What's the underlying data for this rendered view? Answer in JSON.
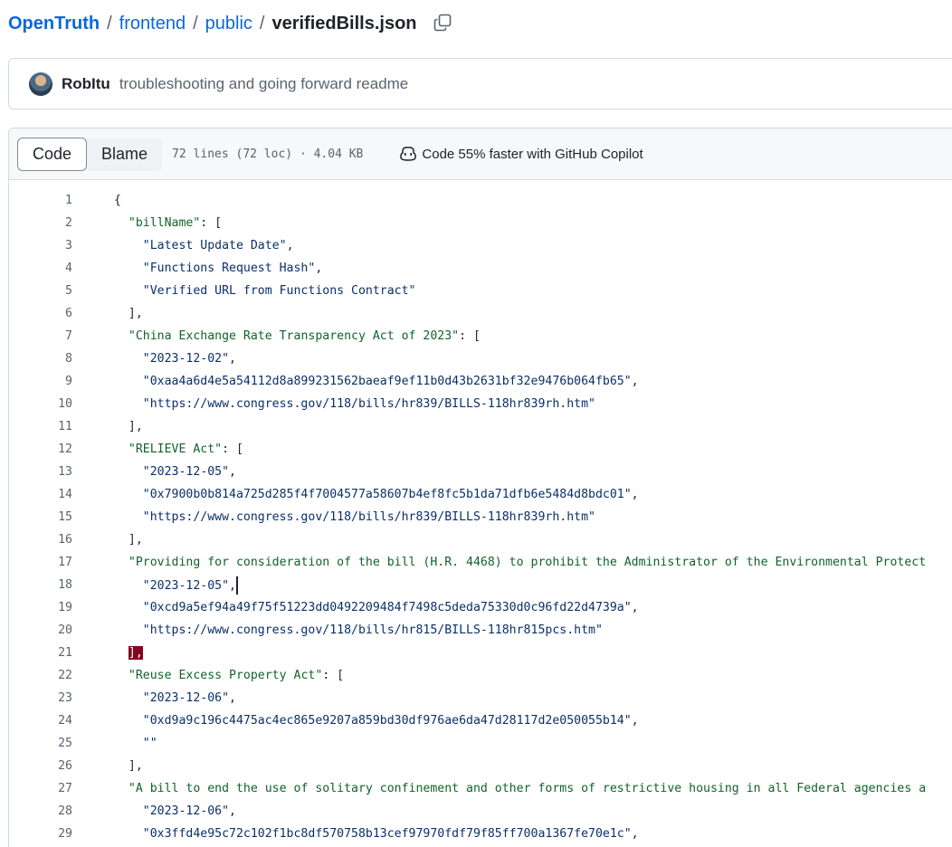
{
  "breadcrumb": {
    "repo": "OpenTruth",
    "path": [
      "frontend",
      "public"
    ],
    "separator": "/",
    "file": "verifiedBills.json"
  },
  "commit": {
    "author": "RobItu",
    "message": "troubleshooting and going forward readme"
  },
  "file_header": {
    "tabs": [
      {
        "label": "Code",
        "active": true
      },
      {
        "label": "Blame",
        "active": false
      }
    ],
    "meta": "72 lines (72 loc) · 4.04 KB",
    "copilot": "Code 55% faster with GitHub Copilot"
  },
  "colors": {
    "link": "#0969da",
    "string": "#0a3069",
    "key": "#116329",
    "bracket_highlight": "#82071e"
  },
  "code_lines": [
    {
      "n": "1",
      "t": "{"
    },
    {
      "n": "2",
      "t": "  \"billName\": ["
    },
    {
      "n": "3",
      "t": "    \"Latest Update Date\","
    },
    {
      "n": "4",
      "t": "    \"Functions Request Hash\","
    },
    {
      "n": "5",
      "t": "    \"Verified URL from Functions Contract\""
    },
    {
      "n": "6",
      "t": "  ],"
    },
    {
      "n": "7",
      "t": "  \"China Exchange Rate Transparency Act of 2023\": ["
    },
    {
      "n": "8",
      "t": "    \"2023-12-02\","
    },
    {
      "n": "9",
      "t": "    \"0xaa4a6d4e5a54112d8a899231562baeaf9ef11b0d43b2631bf32e9476b064fb65\","
    },
    {
      "n": "10",
      "t": "    \"https://www.congress.gov/118/bills/hr839/BILLS-118hr839rh.htm\""
    },
    {
      "n": "11",
      "t": "  ],"
    },
    {
      "n": "12",
      "t": "  \"RELIEVE Act\": ["
    },
    {
      "n": "13",
      "t": "    \"2023-12-05\","
    },
    {
      "n": "14",
      "t": "    \"0x7900b0b814a725d285f4f7004577a58607b4ef8fc5b1da71dfb6e5484d8bdc01\","
    },
    {
      "n": "15",
      "t": "    \"https://www.congress.gov/118/bills/hr839/BILLS-118hr839rh.htm\""
    },
    {
      "n": "16",
      "t": "  ],"
    },
    {
      "n": "17",
      "t": "  \"Providing for consideration of the bill (H.R. 4468) to prohibit the Administrator of the Environmental Protect"
    },
    {
      "n": "18",
      "t": "    \"2023-12-05\","
    },
    {
      "n": "19",
      "t": "    \"0xcd9a5ef94a49f75f51223dd0492209484f7498c5deda75330d0c96fd22d4739a\","
    },
    {
      "n": "20",
      "t": "    \"https://www.congress.gov/118/bills/hr815/BILLS-118hr815pcs.htm\""
    },
    {
      "n": "21",
      "t": "  ],"
    },
    {
      "n": "22",
      "t": "  \"Reuse Excess Property Act\": ["
    },
    {
      "n": "23",
      "t": "    \"2023-12-06\","
    },
    {
      "n": "24",
      "t": "    \"0xd9a9c196c4475ac4ec865e9207a859bd30df976ae6da47d28117d2e050055b14\","
    },
    {
      "n": "25",
      "t": "    \"\""
    },
    {
      "n": "26",
      "t": "  ],"
    },
    {
      "n": "27",
      "t": "  \"A bill to end the use of solitary confinement and other forms of restrictive housing in all Federal agencies a"
    },
    {
      "n": "28",
      "t": "    \"2023-12-06\","
    },
    {
      "n": "29",
      "t": "    \"0x3ffd4e95c72c102f1bc8df570758b13cef97970fdf79f85ff700a1367fe70e1c\","
    }
  ]
}
